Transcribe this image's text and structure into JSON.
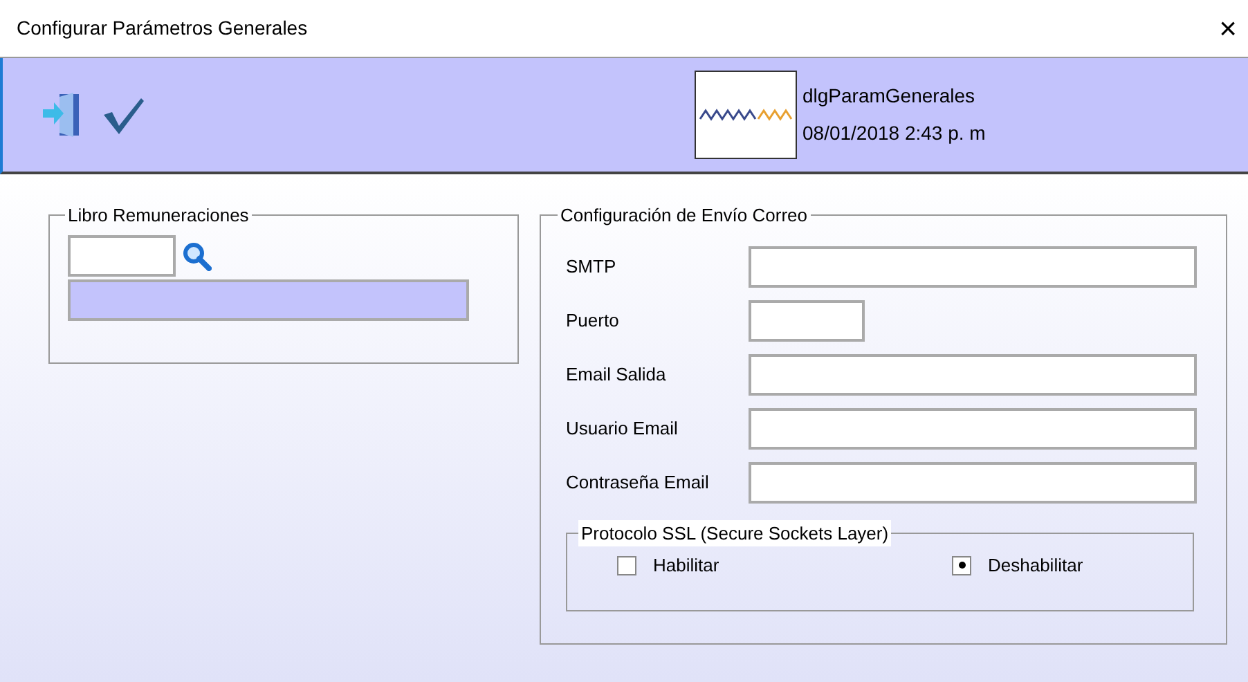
{
  "window": {
    "title": "Configurar Parámetros Generales",
    "close": "×"
  },
  "header": {
    "form_name": "dlgParamGenerales",
    "timestamp": "08/01/2018 2:43 p. m"
  },
  "libro": {
    "legend": "Libro Remuneraciones"
  },
  "correo": {
    "legend": "Configuración de Envío Correo",
    "fields": [
      {
        "label": "SMTP",
        "kind": "long"
      },
      {
        "label": "Puerto",
        "kind": "short"
      },
      {
        "label": "Email Salida",
        "kind": "long"
      },
      {
        "label": "Usuario Email",
        "kind": "long"
      },
      {
        "label": "Contraseña Email",
        "kind": "long"
      }
    ],
    "ssl": {
      "legend": "Protocolo SSL (Secure Sockets Layer)",
      "options": [
        {
          "label": "Habilitar",
          "selected": false
        },
        {
          "label": "Deshabilitar",
          "selected": true
        }
      ]
    }
  }
}
